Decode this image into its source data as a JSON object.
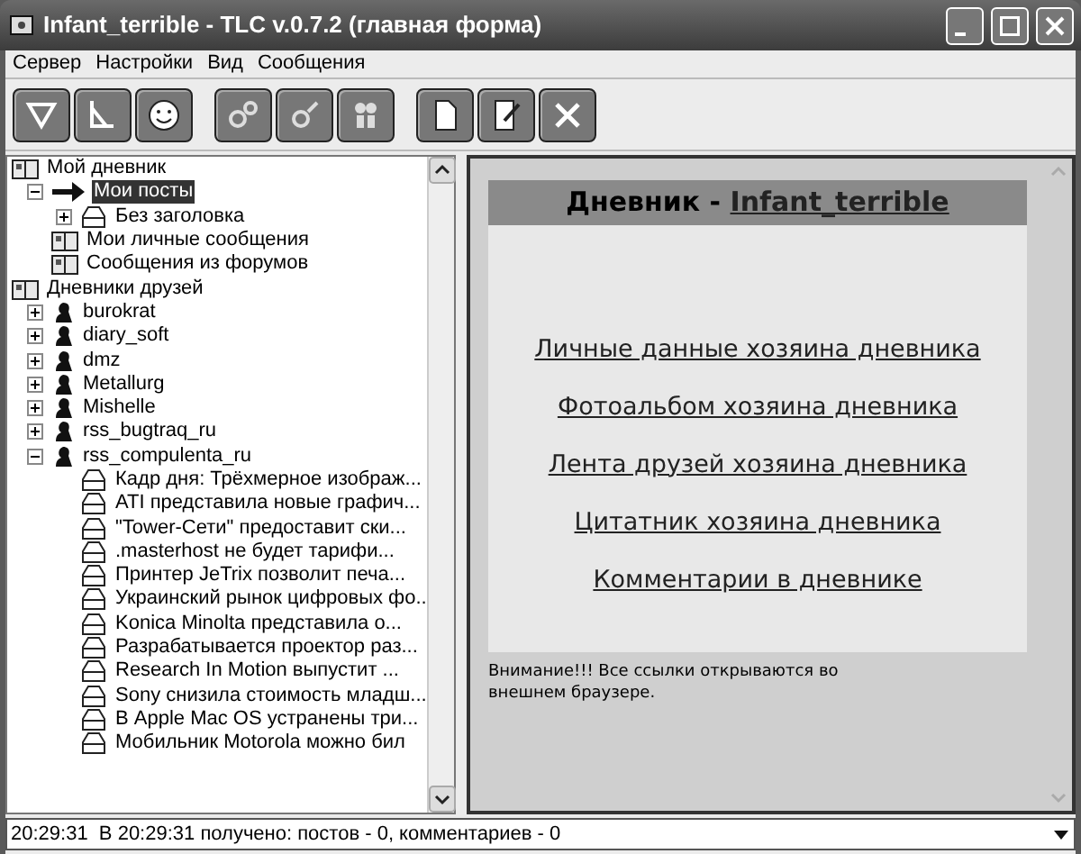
{
  "window": {
    "title": "Infant_terrible - TLC v.0.7.2 (главная форма)"
  },
  "menu": [
    "Сервер",
    "Настройки",
    "Вид",
    "Сообщения"
  ],
  "tree": [
    {
      "label": "Мой дневник",
      "kind": "diary",
      "selected": false,
      "children": [
        {
          "label": "Мои посты",
          "kind": "arrow",
          "selected": true,
          "expanded": true,
          "children": [
            {
              "label": "Без заголовка",
              "kind": "post",
              "selected": false,
              "expanded": false
            }
          ]
        },
        {
          "label": "Мои личные сообщения",
          "kind": "diary",
          "selected": false
        },
        {
          "label": "Сообщения из форумов",
          "kind": "diary",
          "selected": false
        }
      ]
    },
    {
      "label": "Дневники друзей",
      "kind": "diary",
      "selected": false,
      "children": [
        {
          "label": "burokrat",
          "kind": "friend",
          "selected": false,
          "expanded": false
        },
        {
          "label": "diary_soft",
          "kind": "friend",
          "selected": false,
          "expanded": false
        },
        {
          "label": "dmz",
          "kind": "friend",
          "selected": false,
          "expanded": false
        },
        {
          "label": "Metallurg",
          "kind": "friend",
          "selected": false,
          "expanded": false
        },
        {
          "label": "Mishelle",
          "kind": "friend",
          "selected": false,
          "expanded": false
        },
        {
          "label": "rss_bugtraq_ru",
          "kind": "friend",
          "selected": false,
          "expanded": false
        },
        {
          "label": "rss_compulenta_ru",
          "kind": "friend",
          "selected": false,
          "expanded": true,
          "children": [
            {
              "label": "Кадр дня: Трёхмерное изображ...",
              "kind": "post",
              "selected": false
            },
            {
              "label": "ATI представила новые графич...",
              "kind": "post",
              "selected": false
            },
            {
              "label": "\"Tower-Сети\" предоставит ски...",
              "kind": "post",
              "selected": false
            },
            {
              "label": ".masterhost не будет тарифи...",
              "kind": "post",
              "selected": false
            },
            {
              "label": "Принтер JeTrix позволит печа...",
              "kind": "post",
              "selected": false
            },
            {
              "label": "Украинский рынок цифровых фо...",
              "kind": "post",
              "selected": false
            },
            {
              "label": "Konica Minolta представила о...",
              "kind": "post",
              "selected": false
            },
            {
              "label": "Разрабатывается проектор раз...",
              "kind": "post",
              "selected": false
            },
            {
              "label": "Research In Motion выпустит ...",
              "kind": "post",
              "selected": false
            },
            {
              "label": "Sony снизила стоимость младш...",
              "kind": "post",
              "selected": false
            },
            {
              "label": "В Apple Mac OS устранены три...",
              "kind": "post",
              "selected": false
            },
            {
              "label": "Мобильник Motorola можно бил",
              "kind": "post",
              "selected": false
            }
          ]
        }
      ]
    }
  ],
  "page": {
    "heading_prefix": "Дневник - ",
    "heading_link": "Infant_terrible",
    "links": [
      "Личные данные хозяина дневника",
      "Фотоальбом хозяина дневника",
      "Лента друзей хозяина дневника",
      "Цитатник хозяина дневника",
      "Комментарии в дневнике"
    ],
    "note": "Внимание!!! Все ссылки открываются во внешнем браузере."
  },
  "status_bar": {
    "value": "20:29:31  В 20:29:31 получено: постов - 0, комментариев - 0"
  }
}
